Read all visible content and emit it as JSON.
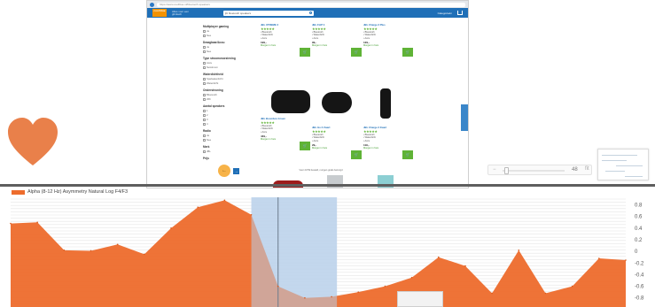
{
  "browser": {
    "url": "https://www.coolblue.nl/bluetooth-speakers",
    "logo": "cool blue",
    "tagline": "Alles voor een glimlach",
    "search_value": "jbl bluetooth speakers",
    "categories_label": "Categorieën",
    "filters": [
      {
        "title": "Multiplayer gaming",
        "options": [
          "Ja",
          "Nee"
        ]
      },
      {
        "title": "Draagbaar/Accu",
        "options": [
          "Ja",
          "Nee"
        ]
      },
      {
        "title": "Type stroomvoorziening",
        "options": [
          "Accu",
          "Netstroom"
        ]
      },
      {
        "title": "Waterdichtheid",
        "options": [
          "Spatwaterdicht",
          "Waterdicht"
        ]
      },
      {
        "title": "Ondersteuning",
        "options": [
          "Bluetooth",
          "Wifi"
        ]
      },
      {
        "title": "Aantal speakers",
        "options": [
          "1",
          "2",
          "3",
          "4"
        ]
      },
      {
        "title": "Radio",
        "options": [
          "Ja",
          "Nee"
        ]
      },
      {
        "title": "Merk",
        "options": [
          "JBL"
        ]
      },
      {
        "title": "Prijs",
        "options": []
      }
    ],
    "products": [
      {
        "name": "JBL XTREME 2",
        "rating": "★★★★★",
        "bullets": [
          "Bluetooth",
          "Waterdicht",
          "Accu"
        ],
        "price": "199,-",
        "stock": "Morgen in huis",
        "cart": "In winkelwagen"
      },
      {
        "name": "JBL FLIP 4",
        "rating": "★★★★★",
        "bullets": [
          "Bluetooth",
          "Waterdicht",
          "Accu"
        ],
        "price": "99,-",
        "stock": "Morgen in huis",
        "cart": "In winkelwagen"
      },
      {
        "name": "JBL Charge 3 Plus",
        "rating": "★★★★★",
        "bullets": [
          "Bluetooth",
          "Waterdicht",
          "Accu"
        ],
        "price": "129,-",
        "stock": "Morgen in huis",
        "cart": "In winkelwagen"
      },
      {
        "name": "JBL Boombox Groen",
        "rating": "★★★★★",
        "bullets": [
          "Bluetooth",
          "Waterdicht",
          "Accu"
        ],
        "price": "449,-",
        "stock": "Morgen in huis",
        "cart": "In winkelwagen"
      },
      {
        "name": "JBL Go 2 Zwart",
        "rating": "★★★★★",
        "bullets": [
          "Bluetooth",
          "Waterdicht",
          "Accu"
        ],
        "price": "29,-",
        "stock": "Morgen in huis",
        "cart": "In winkelwagen"
      },
      {
        "name": "JBL Charge 3 Zwart",
        "rating": "★★★★★",
        "bullets": [
          "Bluetooth",
          "Waterdicht",
          "Accu"
        ],
        "price": "119,-",
        "stock": "Morgen in huis",
        "cart": "In winkelwagen"
      }
    ],
    "prev_button": "←",
    "next_button": "→",
    "info_line": "Voor 23:59 besteld, morgen gratis bezorgd"
  },
  "zoom": {
    "minus": "−",
    "value": "48",
    "reset": "fit"
  },
  "chart_data": {
    "type": "area",
    "series": [
      {
        "name": "Alpha (8-12 Hz) Asymmetry Natural Log F4/F3",
        "color": "#ed6c2c",
        "values": [
          0.48,
          0.5,
          0.02,
          0.01,
          0.12,
          -0.05,
          0.4,
          0.76,
          0.88,
          0.63,
          -0.6,
          -0.8,
          -0.78,
          -0.7,
          -0.6,
          -0.45,
          -0.1,
          -0.25,
          -0.72,
          0.02,
          -0.72,
          -0.6,
          -0.12,
          -0.15
        ]
      }
    ],
    "yticks": [
      "0.8",
      "0.6",
      "0.4",
      "0.2",
      "0",
      "-0.2",
      "-0.4",
      "-0.6",
      "-0.8"
    ],
    "ylim": [
      -0.85,
      0.9
    ],
    "selection_range": [
      9.0,
      12.2
    ],
    "cursor_x": 10.0,
    "grid": true,
    "legend_position": "top-left"
  }
}
